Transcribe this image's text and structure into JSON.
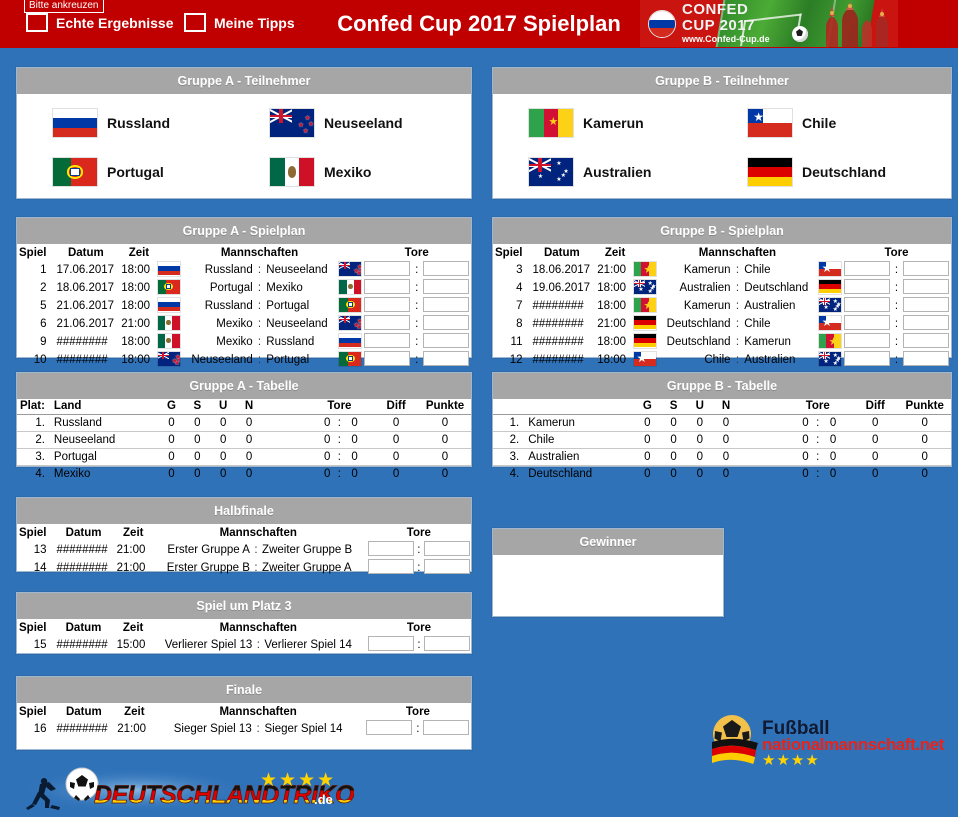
{
  "header": {
    "note": "Bitte ankreuzen",
    "checkbox1_label": "Echte Ergebnisse",
    "checkbox2_label": "Meine Tipps",
    "title": "Confed Cup 2017 Spielplan",
    "logo": {
      "line1": "CONFED",
      "line2": "CUP 2017",
      "line3": "www.Confed-Cup.de"
    },
    "red": "#c00000",
    "background_blue": "#3072b8"
  },
  "participants": {
    "group_a": {
      "title": "Gruppe A - Teilnehmer",
      "teams": [
        "Russland",
        "Neuseeland",
        "Portugal",
        "Mexiko"
      ]
    },
    "group_b": {
      "title": "Gruppe B - Teilnehmer",
      "teams": [
        "Kamerun",
        "Chile",
        "Australien",
        "Deutschland"
      ]
    }
  },
  "schedule_headers": {
    "spiel": "Spiel",
    "datum": "Datum",
    "zeit": "Zeit",
    "mannschaften": "Mannschaften",
    "tore": "Tore",
    "colon": ":"
  },
  "group_a_schedule": {
    "title": "Gruppe A - Spielplan",
    "rows": [
      {
        "spiel": "1",
        "datum": "17.06.2017",
        "zeit": "18:00",
        "home": "Russland",
        "away": "Neuseeland",
        "home_score": "",
        "away_score": ""
      },
      {
        "spiel": "2",
        "datum": "18.06.2017",
        "zeit": "18:00",
        "home": "Portugal",
        "away": "Mexiko",
        "home_score": "",
        "away_score": ""
      },
      {
        "spiel": "5",
        "datum": "21.06.2017",
        "zeit": "18:00",
        "home": "Russland",
        "away": "Portugal",
        "home_score": "",
        "away_score": ""
      },
      {
        "spiel": "6",
        "datum": "21.06.2017",
        "zeit": "21:00",
        "home": "Mexiko",
        "away": "Neuseeland",
        "home_score": "",
        "away_score": ""
      },
      {
        "spiel": "9",
        "datum": "########",
        "zeit": "18:00",
        "home": "Mexiko",
        "away": "Russland",
        "home_score": "",
        "away_score": ""
      },
      {
        "spiel": "10",
        "datum": "########",
        "zeit": "18:00",
        "home": "Neuseeland",
        "away": "Portugal",
        "home_score": "",
        "away_score": ""
      }
    ]
  },
  "group_b_schedule": {
    "title": "Gruppe B - Spielplan",
    "rows": [
      {
        "spiel": "3",
        "datum": "18.06.2017",
        "zeit": "21:00",
        "home": "Kamerun",
        "away": "Chile",
        "home_score": "",
        "away_score": ""
      },
      {
        "spiel": "4",
        "datum": "19.06.2017",
        "zeit": "18:00",
        "home": "Australien",
        "away": "Deutschland",
        "home_score": "",
        "away_score": ""
      },
      {
        "spiel": "7",
        "datum": "########",
        "zeit": "18:00",
        "home": "Kamerun",
        "away": "Australien",
        "home_score": "",
        "away_score": ""
      },
      {
        "spiel": "8",
        "datum": "########",
        "zeit": "21:00",
        "home": "Deutschland",
        "away": "Chile",
        "home_score": "",
        "away_score": ""
      },
      {
        "spiel": "11",
        "datum": "########",
        "zeit": "18:00",
        "home": "Deutschland",
        "away": "Kamerun",
        "home_score": "",
        "away_score": ""
      },
      {
        "spiel": "12",
        "datum": "########",
        "zeit": "18:00",
        "home": "Chile",
        "away": "Australien",
        "home_score": "",
        "away_score": ""
      }
    ]
  },
  "table_headers": {
    "platz": "Plat:",
    "land": "Land",
    "g": "G",
    "s": "S",
    "u": "U",
    "n": "N",
    "tore": "Tore",
    "diff": "Diff",
    "punkte": "Punkte",
    "colon": ":"
  },
  "group_a_table": {
    "title": "Gruppe A - Tabelle",
    "show_first_headers": true,
    "rows": [
      {
        "platz": "1.",
        "land": "Russland",
        "g": "0",
        "s": "0",
        "u": "0",
        "n": "0",
        "tore_f": "0",
        "tore_a": "0",
        "diff": "0",
        "punkte": "0"
      },
      {
        "platz": "2.",
        "land": "Neuseeland",
        "g": "0",
        "s": "0",
        "u": "0",
        "n": "0",
        "tore_f": "0",
        "tore_a": "0",
        "diff": "0",
        "punkte": "0"
      },
      {
        "platz": "3.",
        "land": "Portugal",
        "g": "0",
        "s": "0",
        "u": "0",
        "n": "0",
        "tore_f": "0",
        "tore_a": "0",
        "diff": "0",
        "punkte": "0"
      },
      {
        "platz": "4.",
        "land": "Mexiko",
        "g": "0",
        "s": "0",
        "u": "0",
        "n": "0",
        "tore_f": "0",
        "tore_a": "0",
        "diff": "0",
        "punkte": "0"
      }
    ]
  },
  "group_b_table": {
    "title": "Gruppe B - Tabelle",
    "show_first_headers": false,
    "platz": "",
    "land": "",
    "rows": [
      {
        "platz": "1.",
        "land": "Kamerun",
        "g": "0",
        "s": "0",
        "u": "0",
        "n": "0",
        "tore_f": "0",
        "tore_a": "0",
        "diff": "0",
        "punkte": "0"
      },
      {
        "platz": "2.",
        "land": "Chile",
        "g": "0",
        "s": "0",
        "u": "0",
        "n": "0",
        "tore_f": "0",
        "tore_a": "0",
        "diff": "0",
        "punkte": "0"
      },
      {
        "platz": "3.",
        "land": "Australien",
        "g": "0",
        "s": "0",
        "u": "0",
        "n": "0",
        "tore_f": "0",
        "tore_a": "0",
        "diff": "0",
        "punkte": "0"
      },
      {
        "platz": "4.",
        "land": "Deutschland",
        "g": "0",
        "s": "0",
        "u": "0",
        "n": "0",
        "tore_f": "0",
        "tore_a": "0",
        "diff": "0",
        "punkte": "0"
      }
    ]
  },
  "semifinals": {
    "title": "Halbfinale",
    "rows": [
      {
        "spiel": "13",
        "datum": "########",
        "zeit": "21:00",
        "home": "Erster Gruppe A",
        "away": "Zweiter Gruppe B",
        "home_score": "",
        "away_score": ""
      },
      {
        "spiel": "14",
        "datum": "########",
        "zeit": "21:00",
        "home": "Erster Gruppe B",
        "away": "Zweiter Gruppe A",
        "home_score": "",
        "away_score": ""
      }
    ]
  },
  "third_place": {
    "title": "Spiel um Platz 3",
    "rows": [
      {
        "spiel": "15",
        "datum": "########",
        "zeit": "15:00",
        "home": "Verlierer Spiel 13",
        "away": "Verlierer Spiel 14",
        "home_score": "",
        "away_score": ""
      }
    ]
  },
  "final": {
    "title": "Finale",
    "rows": [
      {
        "spiel": "16",
        "datum": "########",
        "zeit": "21:00",
        "home": "Sieger Spiel 13",
        "away": "Sieger Spiel 14",
        "home_score": "",
        "away_score": ""
      }
    ]
  },
  "winner": {
    "title": "Gewinner",
    "value": ""
  },
  "footer_logos": {
    "deutschlandtrikot": {
      "name": "DEUTSCHLANDTRIKOT",
      "tld": ".de",
      "stars": "★★★★"
    },
    "fussball_nationalmannschaft": {
      "line1": "Fußball",
      "line2": "nationalmannschaft.net",
      "stars": "★★★★"
    }
  }
}
